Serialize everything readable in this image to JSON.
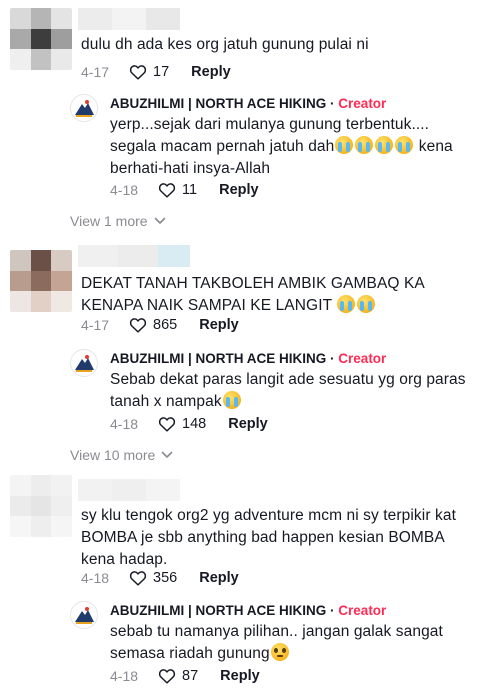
{
  "comments": [
    {
      "text": "dulu dh ada kes org jatuh gunung pulai ni",
      "date": "4-17",
      "likes": "17",
      "reply_label": "Reply",
      "reply": {
        "author": "ABUZHILMI | NORTH ACE HIKING",
        "separator": "·",
        "badge": "Creator",
        "text_line1": "yerp...sejak dari mulanya gunung terbentuk....",
        "text_line2a": "segala macam pernah jatuh dah",
        "text_line2b": " kena",
        "text_line3": "berhati-hati insya-Allah",
        "date": "4-18",
        "likes": "11",
        "reply_label": "Reply"
      },
      "view_more": "View 1 more"
    },
    {
      "text_line1": "DEKAT TANAH TAKBOLEH AMBIK GAMBAQ KA",
      "text_line2": "KENAPA NAIK SAMPAI KE LANGIT ",
      "date": "4-17",
      "likes": "865",
      "reply_label": "Reply",
      "reply": {
        "author": "ABUZHILMI | NORTH ACE HIKING",
        "separator": "·",
        "badge": "Creator",
        "text_line1": "Sebab dekat paras langit ade sesuatu yg org paras",
        "text_line2": "tanah x nampak",
        "date": "4-18",
        "likes": "148",
        "reply_label": "Reply"
      },
      "view_more": "View 10 more"
    },
    {
      "text_line1": "sy klu tengok org2 yg adventure mcm ni sy terpikir kat",
      "text_line2": "BOMBA je sbb anything bad happen kesian BOMBA",
      "text_line3": "kena hadap.",
      "date": "4-18",
      "likes": "356",
      "reply_label": "Reply",
      "reply": {
        "author": "ABUZHILMI | NORTH ACE HIKING",
        "separator": "·",
        "badge": "Creator",
        "text_line1": "sebab tu namanya pilihan.. jangan galak sangat",
        "text_line2": "semasa riadah gunung",
        "date": "4-18",
        "likes": "87",
        "reply_label": "Reply"
      }
    }
  ],
  "icons": {
    "like": "heart-outline-icon",
    "chevron": "chevron-down-icon",
    "cry_emoji": "loudly-crying-face-emoji",
    "plead_emoji": "pleading-face-emoji",
    "creator_avatar": "hiker-logo-avatar"
  },
  "colors": {
    "badge": "#fe2c55",
    "muted": "#8a8b91",
    "text": "#161823"
  }
}
